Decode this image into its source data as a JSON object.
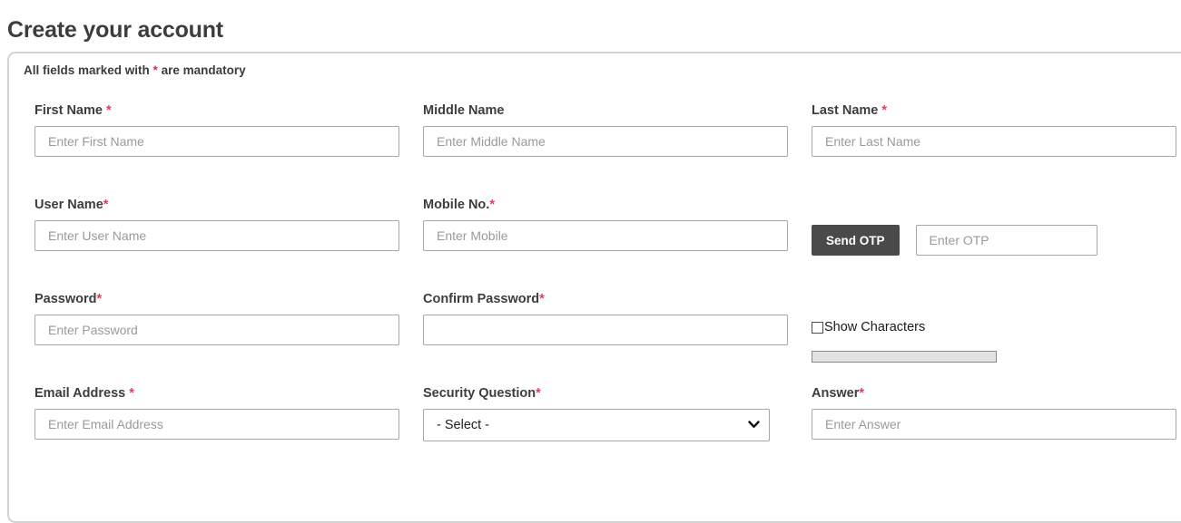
{
  "page": {
    "title": "Create your account"
  },
  "card": {
    "mandatory_note_before": "All fields marked with ",
    "mandatory_note_star": "*",
    "mandatory_note_after": " are mandatory"
  },
  "form": {
    "rows": [
      {
        "fields": [
          {
            "label": "First Name ",
            "required": true,
            "required_mark": "*",
            "placeholder": "Enter First Name",
            "value": ""
          },
          {
            "label": "Middle Name",
            "required": false,
            "required_mark": "",
            "placeholder": "Enter Middle Name",
            "value": ""
          },
          {
            "label": "Last Name ",
            "required": true,
            "required_mark": "*",
            "placeholder": "Enter Last Name",
            "value": ""
          }
        ]
      },
      {
        "fields": [
          {
            "label": "User Name",
            "required": true,
            "required_mark": "*",
            "placeholder": "Enter User Name",
            "value": ""
          },
          {
            "label": "Mobile No.",
            "required": true,
            "required_mark": "*",
            "placeholder": "Enter Mobile",
            "value": ""
          }
        ]
      },
      {
        "fields": [
          {
            "label": "Password",
            "required": true,
            "required_mark": "*",
            "placeholder": "Enter Password",
            "value": ""
          },
          {
            "label": "Confirm Password",
            "required": true,
            "required_mark": "*",
            "placeholder": "",
            "value": ""
          }
        ]
      },
      {
        "fields": [
          {
            "label": "Email Address ",
            "required": true,
            "required_mark": "*",
            "placeholder": "Enter Email Address",
            "value": ""
          },
          {
            "label": "Security Question",
            "required": true,
            "required_mark": "*",
            "placeholder": "",
            "value": ""
          },
          {
            "label": "Answer",
            "required": true,
            "required_mark": "*",
            "placeholder": "Enter Answer",
            "value": ""
          }
        ]
      }
    ],
    "otp": {
      "button_label": "Send OTP",
      "input_placeholder": "Enter OTP",
      "input_value": ""
    },
    "password_options": {
      "show_characters_label": "Show Characters",
      "show_characters_checked": false,
      "strength_percent": 0
    },
    "security_question": {
      "selected": "- Select -",
      "options": [
        "- Select -"
      ]
    }
  },
  "colors": {
    "required_star": "#d0455e",
    "note_star": "#c23b52",
    "button_bg": "#4a4a4a",
    "input_border": "#a6a6a6",
    "card_border": "#d3d3d3",
    "strength_track": "#e2e2e2"
  }
}
